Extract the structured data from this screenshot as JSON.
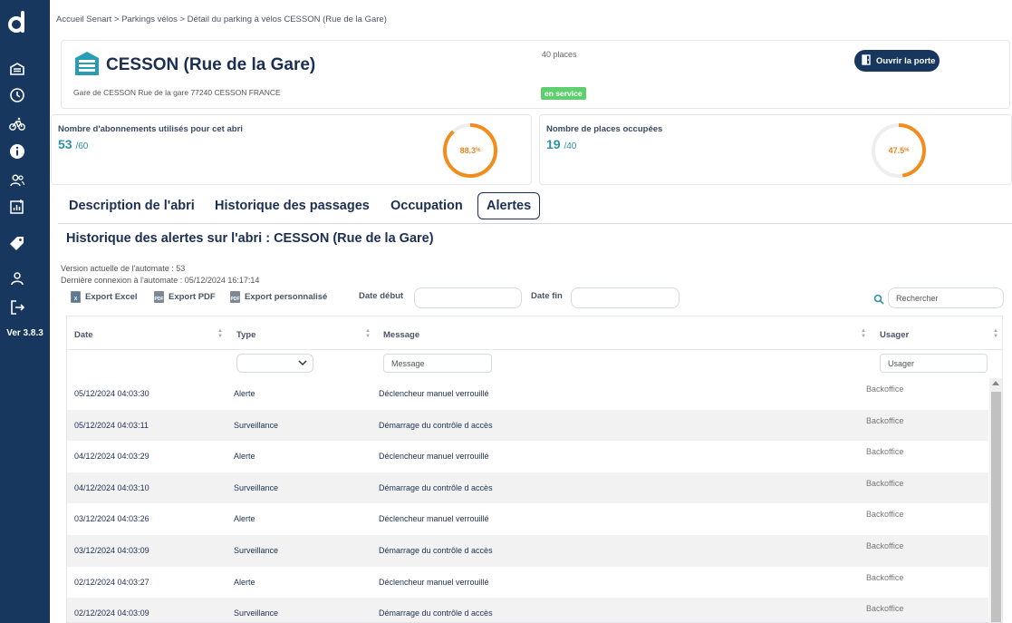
{
  "app": {
    "version": "Ver 3.8.3"
  },
  "breadcrumb": "Accueil Senart > Parkings vélos > Détail du parking à vélos CESSON (Rue de la Gare)",
  "header": {
    "title": "CESSON (Rue de la Gare)",
    "address": "Gare de CESSON Rue de la gare 77240 CESSON FRANCE",
    "places": "40 places",
    "status": "en service",
    "open_door_label": "Ouvrir la porte"
  },
  "stats": {
    "subscriptions": {
      "label": "Nombre d'abonnements utilisés pour cet abri",
      "value": "53",
      "total": "/60",
      "percent": "88.3",
      "fraction": 0.883
    },
    "occupied": {
      "label": "Nombre de places occupées",
      "value": "19",
      "total": "/40",
      "percent": "47.5",
      "fraction": 0.475
    },
    "percent_sign": "%"
  },
  "tabs": [
    "Description de l'abri",
    "Historique des passages",
    "Occupation",
    "Alertes"
  ],
  "active_tab": "Alertes",
  "section": {
    "title": "Historique des alertes sur l'abri : CESSON (Rue de la Gare)",
    "version_line": "Version actuelle de l'automate : 53",
    "connection_line": "Dernière connexion à l'automate : 05/12/2024 16:17:14"
  },
  "toolbar": {
    "export_excel": "Export Excel",
    "export_pdf": "Export PDF",
    "export_custom": "Export personnalisé",
    "date_start_label": "Date début",
    "date_end_label": "Date fin",
    "search_placeholder": "Rechercher"
  },
  "table": {
    "columns": [
      "Date",
      "Type",
      "Message",
      "Usager"
    ],
    "message_filter_placeholder": "Message",
    "user_filter_placeholder": "Usager",
    "rows": [
      {
        "date": "05/12/2024 04:03:30",
        "type": "Alerte",
        "message": "Déclencheur manuel verrouillé",
        "user": "Backoffice"
      },
      {
        "date": "05/12/2024 04:03:11",
        "type": "Surveillance",
        "message": "Démarrage du contrôle d accès",
        "user": "Backoffice"
      },
      {
        "date": "04/12/2024 04:03:29",
        "type": "Alerte",
        "message": "Déclencheur manuel verrouillé",
        "user": "Backoffice"
      },
      {
        "date": "04/12/2024 04:03:10",
        "type": "Surveillance",
        "message": "Démarrage du contrôle d accès",
        "user": "Backoffice"
      },
      {
        "date": "03/12/2024 04:03:26",
        "type": "Alerte",
        "message": "Déclencheur manuel verrouillé",
        "user": "Backoffice"
      },
      {
        "date": "03/12/2024 04:03:09",
        "type": "Surveillance",
        "message": "Démarrage du contrôle d accès",
        "user": "Backoffice"
      },
      {
        "date": "02/12/2024 04:03:27",
        "type": "Alerte",
        "message": "Déclencheur manuel verrouillé",
        "user": "Backoffice"
      },
      {
        "date": "02/12/2024 04:03:09",
        "type": "Surveillance",
        "message": "Démarrage du contrôle d accès",
        "user": "Backoffice"
      }
    ]
  },
  "colors": {
    "sidebar": "#17375e",
    "accent": "#2e8fa8",
    "gauge": "#f28c1b",
    "status": "#5ece6e"
  },
  "icons": [
    "logo-icon",
    "parking-icon",
    "clock-icon",
    "bike-icon",
    "info-icon",
    "users-icon",
    "report-icon",
    "tag-icon",
    "user-icon",
    "logout-icon",
    "door-icon",
    "excel-icon",
    "pdf-icon",
    "search-icon",
    "chevron-down-icon"
  ]
}
